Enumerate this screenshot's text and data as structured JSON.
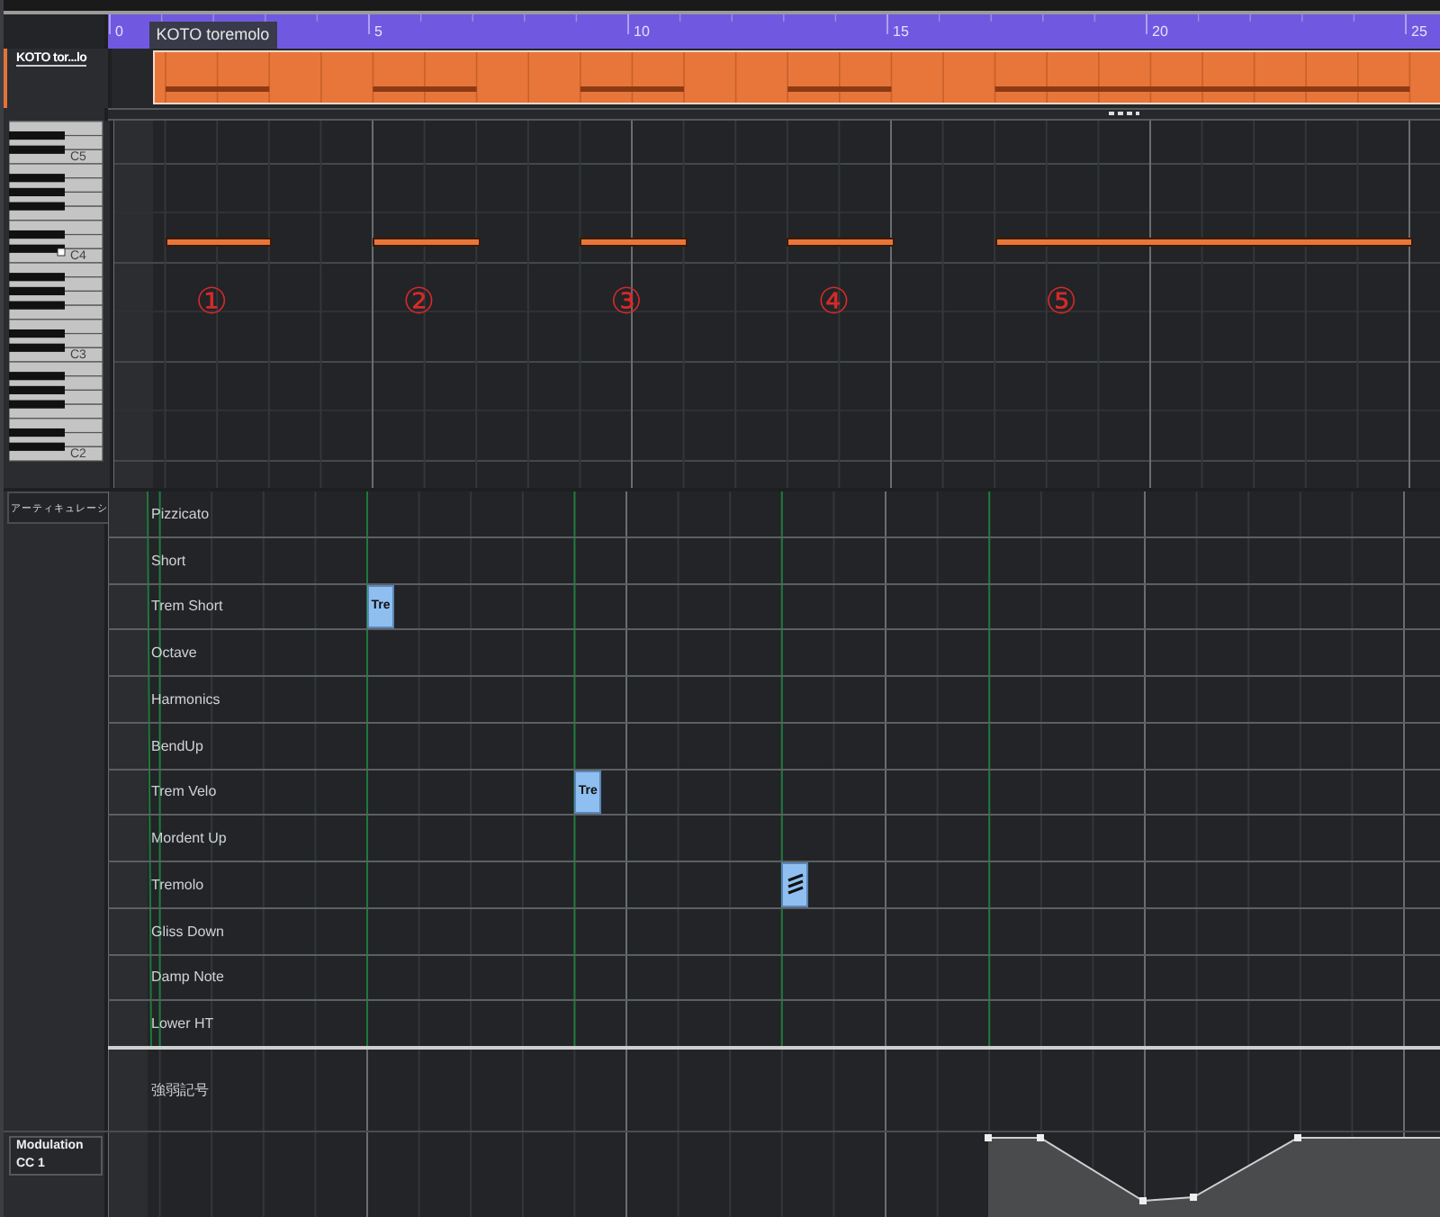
{
  "track": {
    "name": "KOTO tor...lo"
  },
  "ruler": {
    "labels": [
      "0",
      "5",
      "10",
      "15",
      "20",
      "25"
    ],
    "part_tag": "KOTO toremolo"
  },
  "keyboard": {
    "octave_labels": [
      "C5",
      "C4",
      "C3",
      "C2"
    ]
  },
  "notes": [
    {
      "annotation": "①"
    },
    {
      "annotation": "②"
    },
    {
      "annotation": "③"
    },
    {
      "annotation": "④"
    },
    {
      "annotation": "⑤"
    }
  ],
  "articulations": {
    "header": "アーティキュレーシ",
    "lanes": [
      {
        "name": "Pizzicato"
      },
      {
        "name": "Short"
      },
      {
        "name": "Trem Short",
        "events": [
          {
            "kind": "text",
            "label": "Tre"
          }
        ]
      },
      {
        "name": "Octave"
      },
      {
        "name": "Harmonics"
      },
      {
        "name": "BendUp"
      },
      {
        "name": "Trem Velo",
        "events": [
          {
            "kind": "text",
            "label": "Tre"
          }
        ]
      },
      {
        "name": "Mordent Up"
      },
      {
        "name": "Tremolo",
        "events": [
          {
            "kind": "icon"
          }
        ]
      },
      {
        "name": "Gliss Down"
      },
      {
        "name": "Damp Note"
      },
      {
        "name": "Lower HT"
      }
    ]
  },
  "dynamics": {
    "name": "強弱記号"
  },
  "controller": {
    "name": "Modulation",
    "cc": "CC 1"
  }
}
